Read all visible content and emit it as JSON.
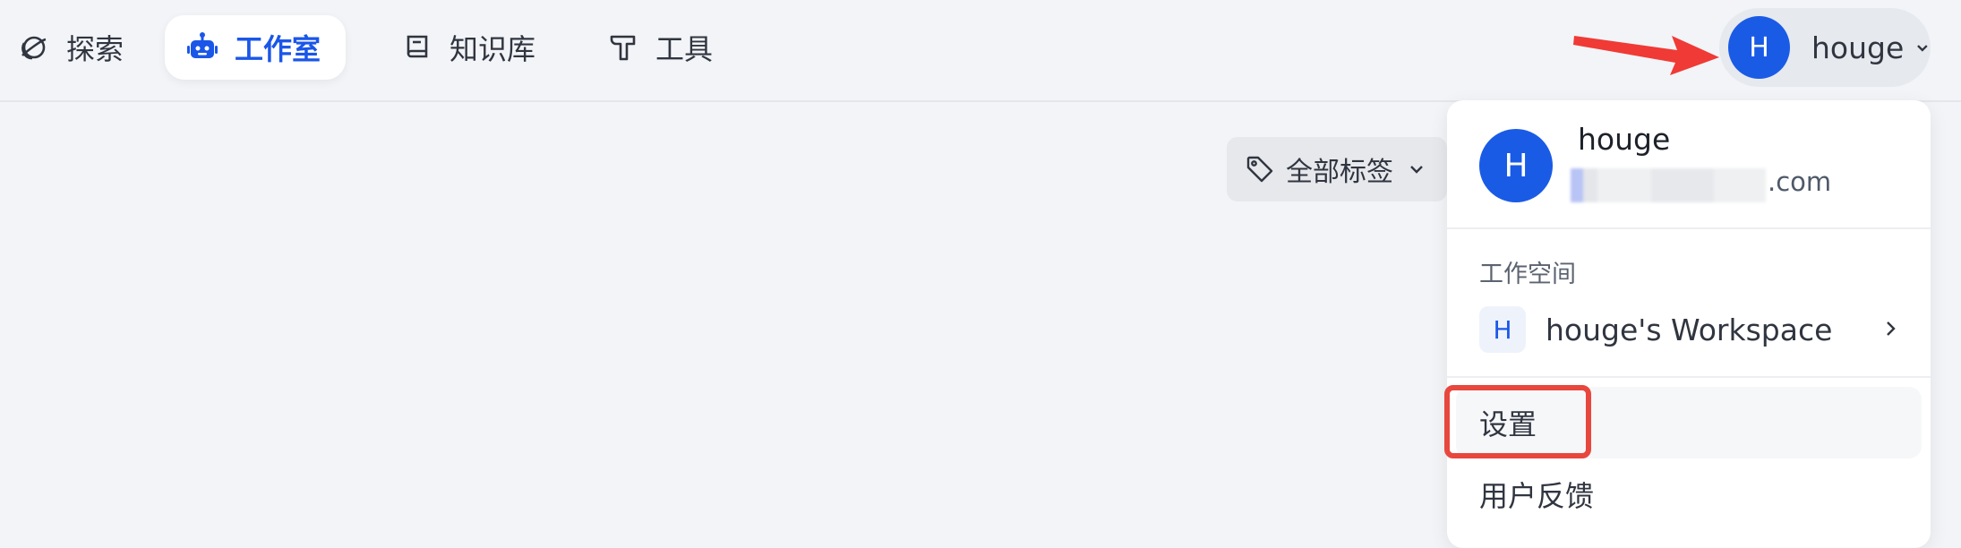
{
  "nav": {
    "items": [
      {
        "label": "探索",
        "icon": "planet-icon",
        "active": false
      },
      {
        "label": "工作室",
        "icon": "robot-icon",
        "active": true
      },
      {
        "label": "知识库",
        "icon": "book-icon",
        "active": false
      },
      {
        "label": "工具",
        "icon": "hammer-icon",
        "active": false
      }
    ]
  },
  "user": {
    "avatar_letter": "H",
    "name": "houge",
    "email_suffix": ".com"
  },
  "tag_filter": {
    "label": "全部标签"
  },
  "dropdown": {
    "workspace_section": "工作空间",
    "workspace": {
      "badge": "H",
      "name": "houge's Workspace"
    },
    "menu": {
      "settings": "设置",
      "feedback": "用户反馈"
    }
  },
  "colors": {
    "accent": "#1a5be6",
    "annotation_red": "#e8473e",
    "background": "#f2f4f7"
  }
}
